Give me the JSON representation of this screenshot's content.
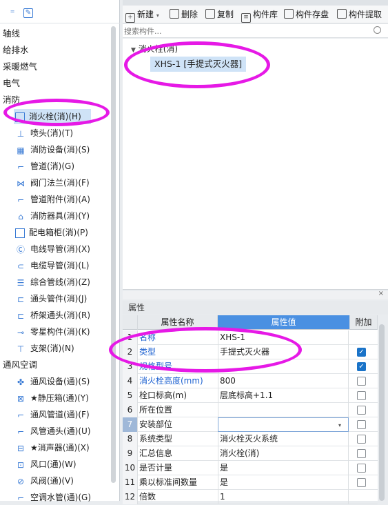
{
  "left_tree": {
    "categories": [
      "轴线",
      "给排水",
      "采暖燃气",
      "电气",
      "消防",
      "通风空调"
    ],
    "fire_items": [
      "消火栓(消)(H)",
      "喷头(消)(T)",
      "消防设备(消)(S)",
      "管道(消)(G)",
      "阀门法兰(消)(F)",
      "管道附件(消)(A)",
      "消防器具(消)(Y)",
      "配电箱柜(消)(P)",
      "电线导管(消)(X)",
      "电缆导管(消)(L)",
      "综合管线(消)(Z)",
      "通头管件(消)(J)",
      "桥架通头(消)(R)",
      "零星构件(消)(K)",
      "支架(消)(N)"
    ],
    "hvac_items": [
      "通风设备(通)(S)",
      "★静压箱(通)(Y)",
      "通风管道(通)(F)",
      "风管通头(通)(U)",
      "★消声器(通)(X)",
      "风口(通)(W)",
      "风阀(通)(V)",
      "空调水管(通)(G)"
    ]
  },
  "toolbar": {
    "new": "新建",
    "delete": "删除",
    "copy": "复制",
    "library": "构件库",
    "save": "构件存盘",
    "extract": "构件提取"
  },
  "search": {
    "placeholder": "搜索构件..."
  },
  "component_tree": {
    "root": "消火栓(消)",
    "child": "XHS-1 [手提式灭火器]"
  },
  "properties": {
    "title": "属性",
    "col_name": "属性名称",
    "col_value": "属性值",
    "col_extra": "附加",
    "rows": [
      {
        "num": "1",
        "name": "名称",
        "value": "XHS-1",
        "checkbox": "none"
      },
      {
        "num": "2",
        "name": "类型",
        "value": "手提式灭火器",
        "checkbox": "checked"
      },
      {
        "num": "3",
        "name": "规格型号",
        "value": "",
        "checkbox": "checked"
      },
      {
        "num": "4",
        "name": "消火栓高度(mm)",
        "value": "800",
        "checkbox": "unchecked"
      },
      {
        "num": "5",
        "name": "栓口标高(m)",
        "value": "层底标高+1.1",
        "checkbox": "unchecked"
      },
      {
        "num": "6",
        "name": "所在位置",
        "value": "",
        "checkbox": "unchecked"
      },
      {
        "num": "7",
        "name": "安装部位",
        "value": "",
        "checkbox": "unchecked"
      },
      {
        "num": "8",
        "name": "系统类型",
        "value": "消火栓灭火系统",
        "checkbox": "unchecked"
      },
      {
        "num": "9",
        "name": "汇总信息",
        "value": "消火栓(消)",
        "checkbox": "unchecked"
      },
      {
        "num": "10",
        "name": "是否计量",
        "value": "是",
        "checkbox": "unchecked"
      },
      {
        "num": "11",
        "name": "乘以标准间数量",
        "value": "是",
        "checkbox": "unchecked"
      },
      {
        "num": "12",
        "name": "倍数",
        "value": "1",
        "checkbox": "unchecked"
      }
    ]
  }
}
